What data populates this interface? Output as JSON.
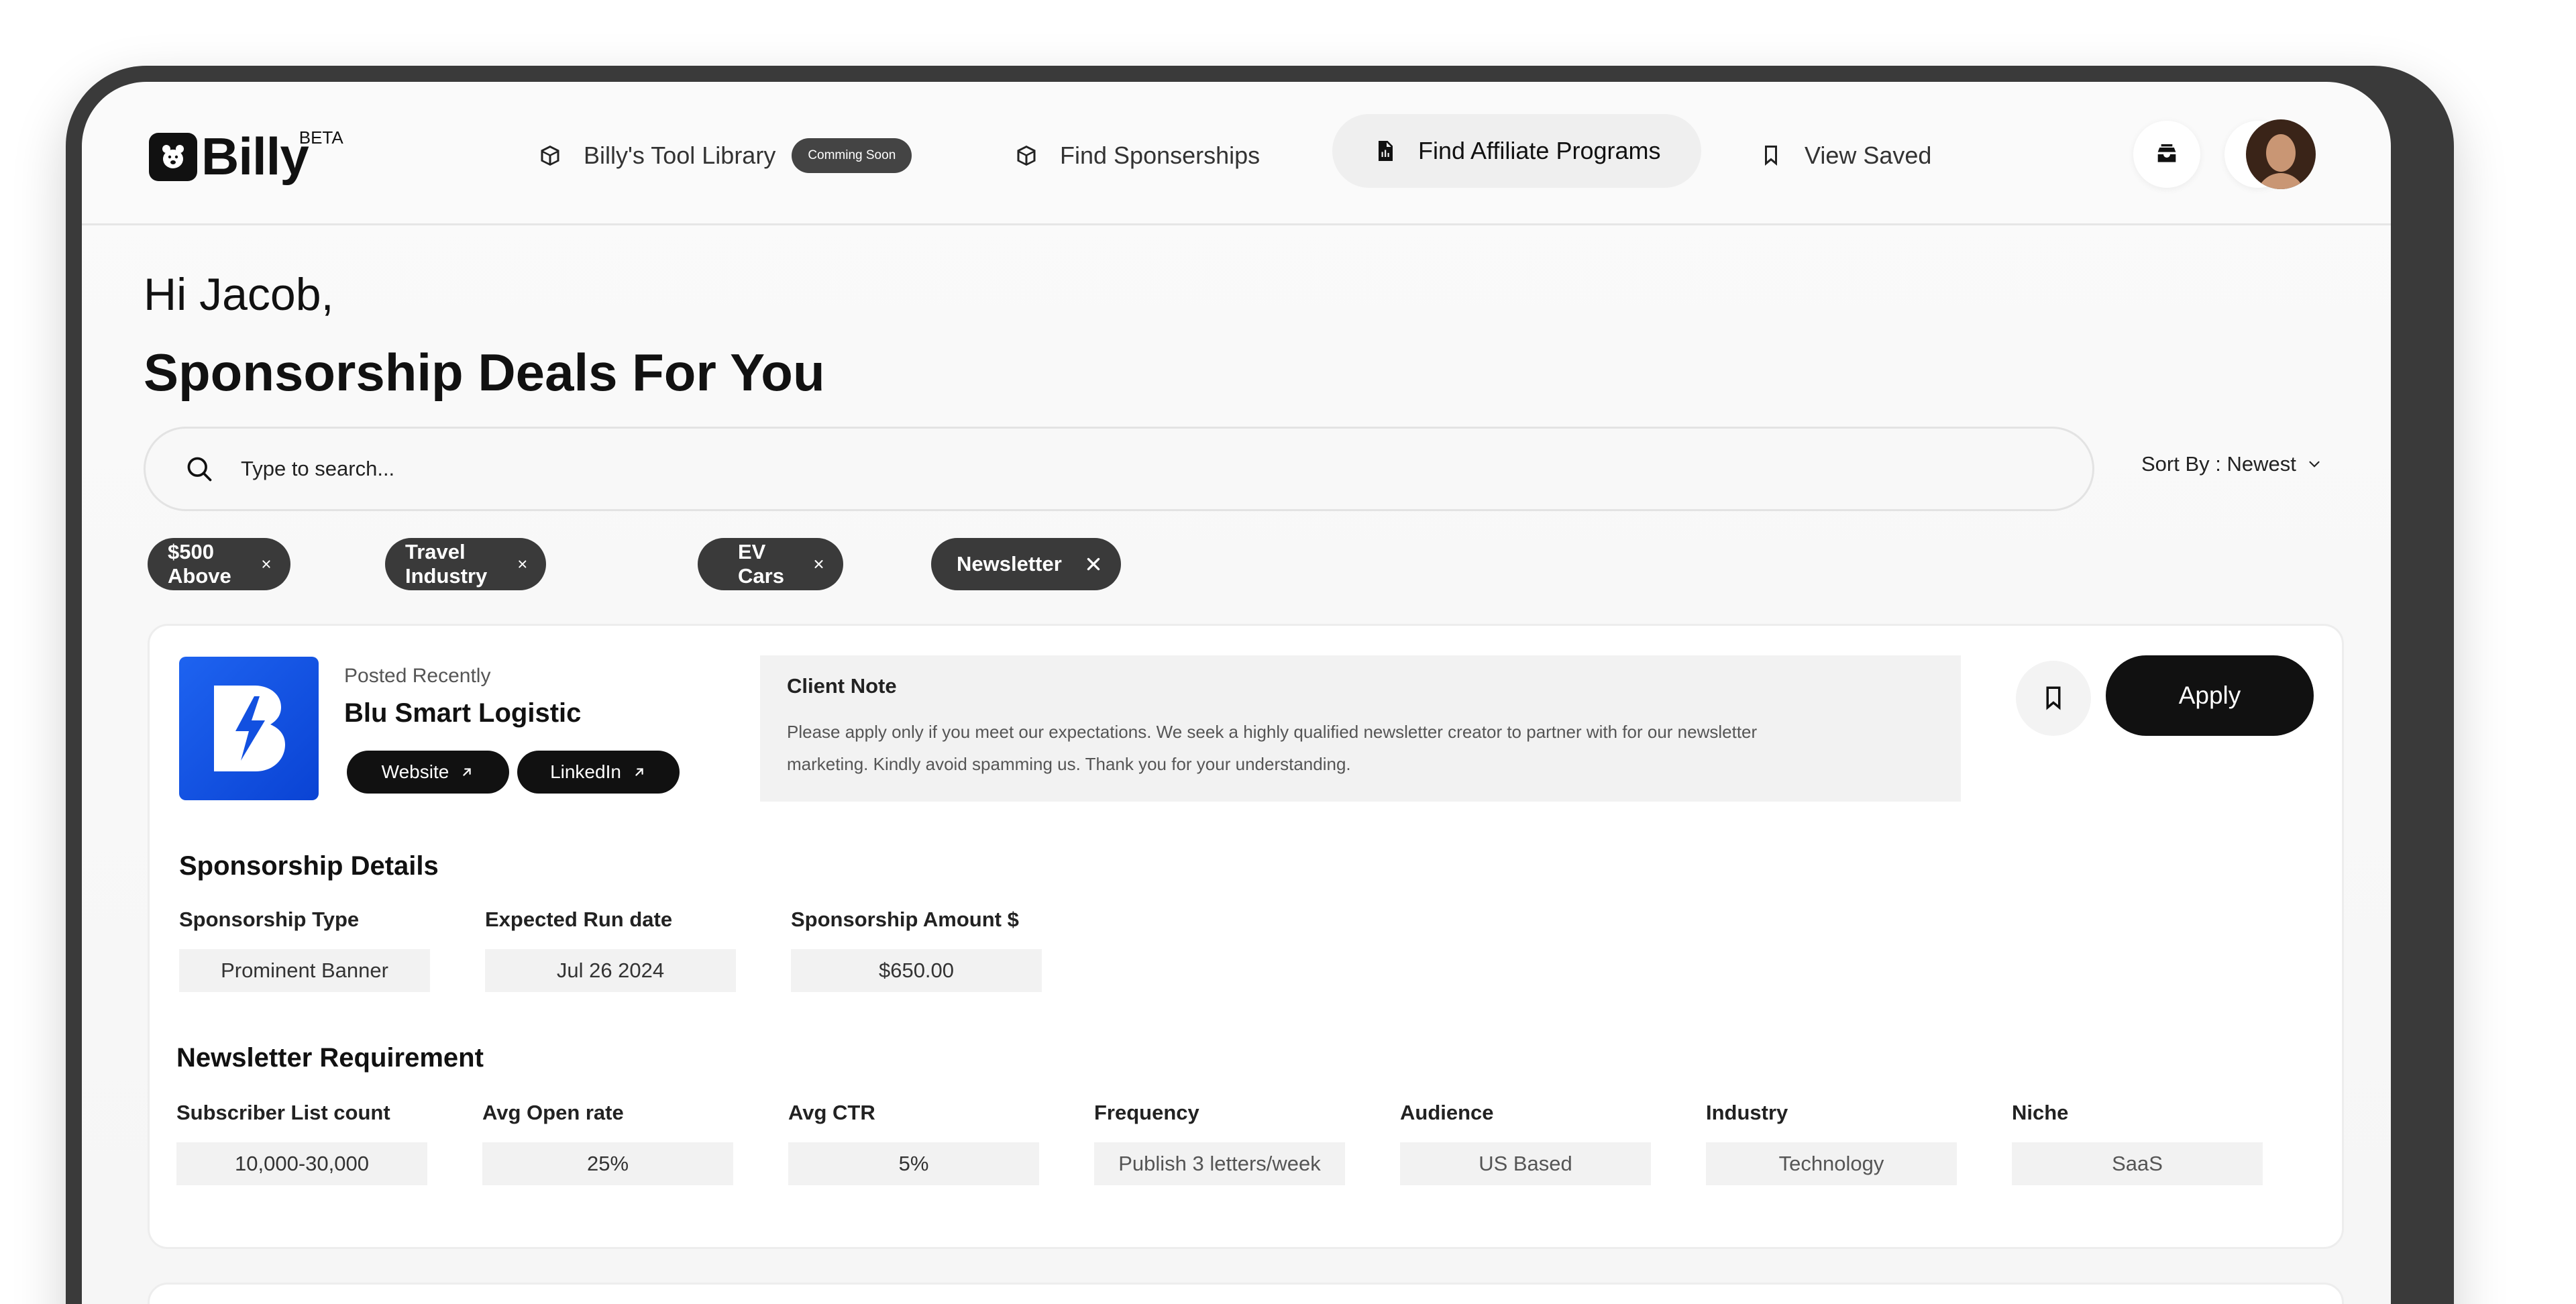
{
  "app": {
    "logo_text": "Billy",
    "logo_badge": "BETA"
  },
  "nav": [
    {
      "label": "Billy's Tool Library",
      "badge": "Comming Soon",
      "icon": "box-icon"
    },
    {
      "label": "Find Sponserships",
      "icon": "box-icon"
    },
    {
      "label": "Find Affiliate Programs",
      "icon": "document-icon",
      "active": true
    },
    {
      "label": "View Saved",
      "icon": "bookmark-icon"
    }
  ],
  "header_icons": [
    "inbox-icon",
    "bell-icon",
    "avatar"
  ],
  "greeting": "Hi Jacob,",
  "page_title": "Sponsorship Deals For You",
  "search": {
    "placeholder": "Type to search..."
  },
  "sort": {
    "label": "Sort By : Newest"
  },
  "filters": [
    "$500 Above",
    "Travel Industry",
    "EV Cars",
    "Newsletter"
  ],
  "deal": {
    "posted": "Posted Recently",
    "company": "Blu Smart Logistic",
    "website_label": "Website",
    "linkedin_label": "LinkedIn",
    "note_title": "Client Note",
    "note_line1": "Please apply only if you meet our expectations. We seek a highly qualified newsletter creator to partner with for our newsletter",
    "note_line2": "marketing. Kindly avoid spamming us. Thank you for your understanding.",
    "apply_label": "Apply",
    "sponsorship_section": "Sponsorship Details",
    "sponsorship_fields": [
      {
        "label": "Sponsorship Type",
        "value": "Prominent Banner"
      },
      {
        "label": "Expected Run date",
        "value": "Jul 26 2024"
      },
      {
        "label": "Sponsorship Amount $",
        "value": "$650.00"
      }
    ],
    "requirement_section": "Newsletter Requirement",
    "requirement_fields": [
      {
        "label": "Subscriber List count",
        "value": "10,000-30,000"
      },
      {
        "label": "Avg Open rate",
        "value": "25%"
      },
      {
        "label": "Avg CTR",
        "value": "5%"
      },
      {
        "label": "Frequency",
        "value": "Publish 3 letters/week"
      },
      {
        "label": "Audience",
        "value": "US Based"
      },
      {
        "label": "Industry",
        "value": "Technology"
      },
      {
        "label": "Niche",
        "value": "SaaS"
      }
    ]
  },
  "colors": {
    "brand_blue": "#1e63f0",
    "dark": "#111111",
    "chip": "#3a3a3a"
  }
}
